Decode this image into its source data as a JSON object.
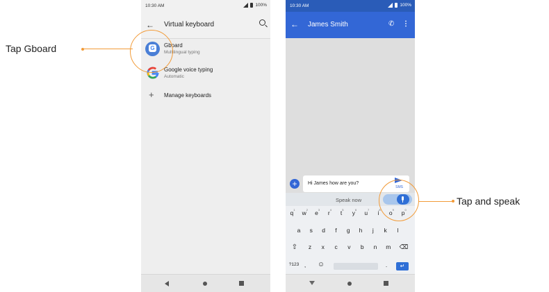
{
  "left_screen": {
    "status_time": "10:30 AM",
    "battery": "100%",
    "title": "Virtual keyboard",
    "items": [
      {
        "title": "Gboard",
        "subtitle": "Multilingual typing"
      },
      {
        "title": "Google voice typing",
        "subtitle": "Automatic"
      }
    ],
    "manage": "Manage keyboards"
  },
  "right_screen": {
    "status_time": "10:30 AM",
    "battery": "100%",
    "contact": "James Smith",
    "message_text": "Hi James how are you?",
    "send_label": "SMS",
    "speak_now": "Speak now",
    "keys_row1": [
      "q",
      "w",
      "e",
      "r",
      "t",
      "y",
      "u",
      "i",
      "o",
      "p"
    ],
    "keys_row1_nums": [
      "1",
      "2",
      "3",
      "4",
      "5",
      "6",
      "7",
      "8",
      "9",
      "0"
    ],
    "keys_row2": [
      "a",
      "s",
      "d",
      "f",
      "g",
      "h",
      "j",
      "k",
      "l"
    ],
    "keys_row3": [
      "z",
      "x",
      "c",
      "v",
      "b",
      "n",
      "m"
    ],
    "key_symbols": "?123",
    "key_comma": ",",
    "key_period": "."
  },
  "callouts": {
    "left": "Tap Gboard",
    "right": "Tap and speak"
  },
  "colors": {
    "accent": "#f29b38",
    "app_bar_blue": "#3367d6",
    "keyboard_blue": "#2f6fd6"
  },
  "icons": [
    "back-arrow-icon",
    "search-icon",
    "gboard-icon",
    "google-g-icon",
    "plus-icon",
    "phone-icon",
    "more-vert-icon",
    "send-icon",
    "mic-icon",
    "shift-icon",
    "backspace-icon",
    "emoji-icon",
    "enter-icon"
  ]
}
